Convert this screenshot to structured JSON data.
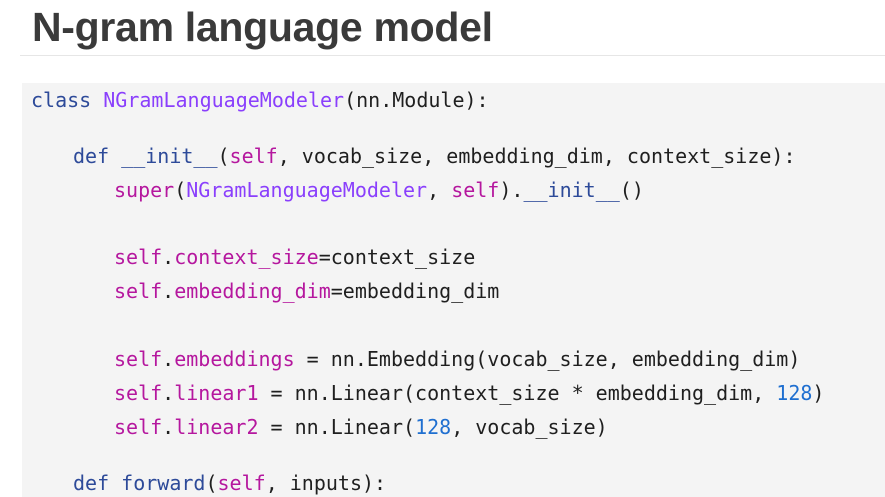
{
  "title": "N-gram language model",
  "code": {
    "line1": {
      "kw": "class",
      "sp": " ",
      "name": "NGramLanguageModeler",
      "rest": "(nn.Module):"
    },
    "line2": {
      "kw": "def",
      "sp": " ",
      "name": "__init__",
      "p1": "(",
      "self": "self",
      "rest": ", vocab_size, embedding_dim, context_size):"
    },
    "line3": {
      "fn": "super",
      "p1": "(",
      "cls": "NGramLanguageModeler",
      "p2": ", ",
      "self": "self",
      "p3": ").",
      "name": "__init__",
      "p4": "()"
    },
    "line4": {
      "self": "self",
      "dot": ".",
      "attr": "context_size",
      "rest": "=context_size"
    },
    "line5": {
      "self": "self",
      "dot": ".",
      "attr": "embedding_dim",
      "rest": "=embedding_dim"
    },
    "line6": {
      "self": "self",
      "dot": ".",
      "attr": "embeddings",
      "rest": " = nn.Embedding(vocab_size, embedding_dim)"
    },
    "line7": {
      "self": "self",
      "dot": ".",
      "attr": "linear1",
      "rest": " = nn.Linear(context_size * embedding_dim, ",
      "num": "128",
      "end": ")"
    },
    "line8": {
      "self": "self",
      "dot": ".",
      "attr": "linear2",
      "rest": " = nn.Linear(",
      "num": "128",
      "end": ", vocab_size)"
    },
    "line9": {
      "kw": "def",
      "sp": " ",
      "name": "forward",
      "p1": "(",
      "self": "self",
      "rest": ", inputs):"
    }
  },
  "colors": {
    "keyword": "#2d4a99",
    "class_name": "#8a3ffc",
    "self": "#b5179e",
    "number": "#1f6fd0",
    "text": "#1f1f1f",
    "title": "#3a3a3a",
    "panel": "#f4f4f4"
  }
}
